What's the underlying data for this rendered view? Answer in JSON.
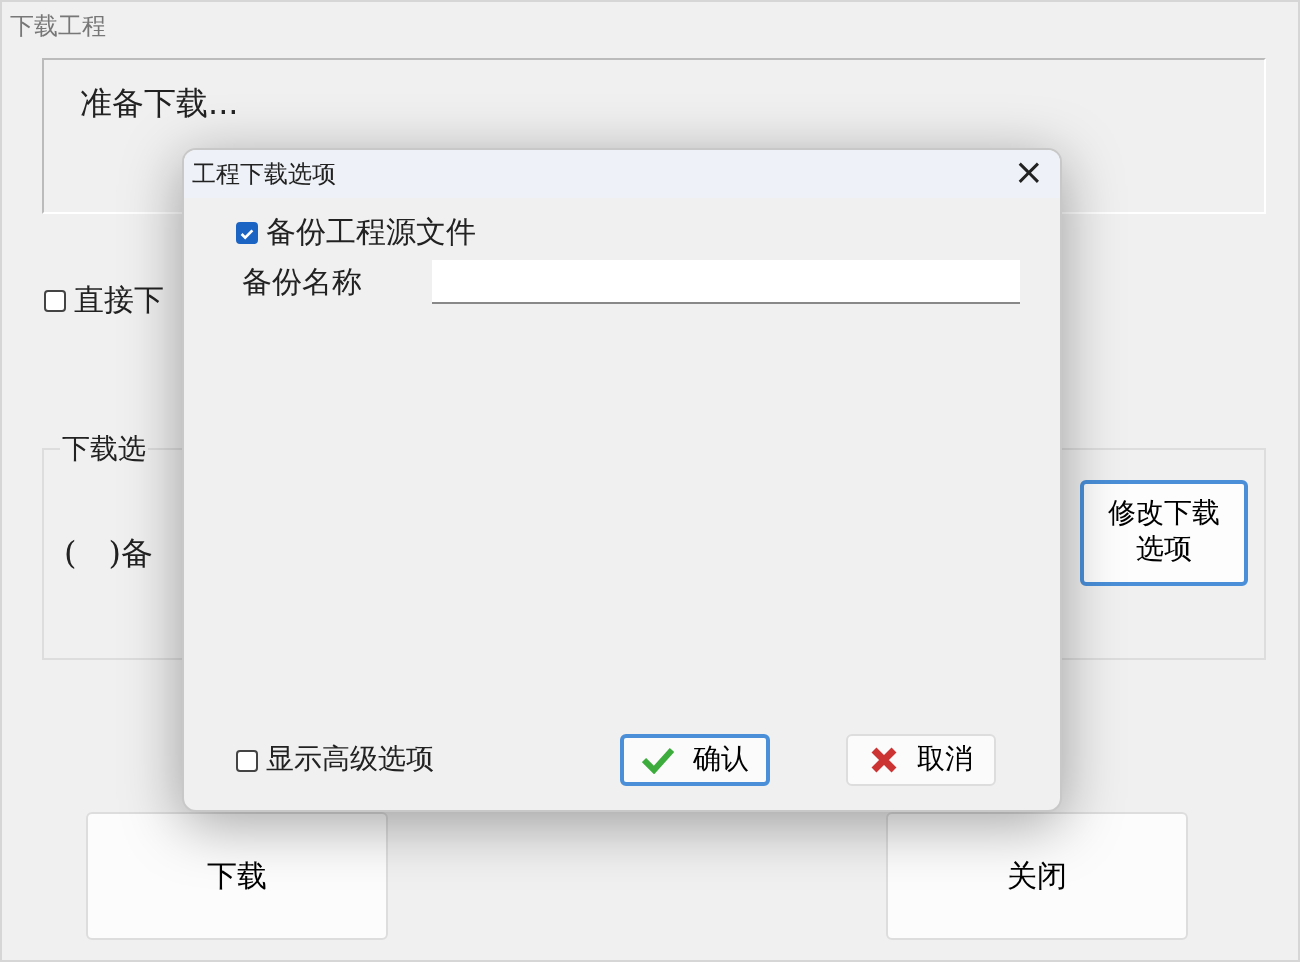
{
  "window": {
    "title": "下载工程"
  },
  "status": {
    "text": "准备下载..."
  },
  "direct_download": {
    "label": "直接下",
    "checked": false
  },
  "download_options": {
    "legend": "下载选",
    "summary": "(　)备",
    "modify_button": "修改下载选项"
  },
  "buttons": [
    {
      "label": "下载"
    },
    {
      "label": "关闭"
    }
  ],
  "dialog": {
    "title": "工程下载选项",
    "close": "×",
    "backup_source": {
      "label": "备份工程源文件",
      "checked": true
    },
    "backup_name": {
      "label": "备份名称"
    },
    "advanced": {
      "label": "显示高级选项",
      "checked": false
    },
    "buttons": [
      {
        "kind": "ok",
        "label": "确认"
      },
      {
        "kind": "cancel",
        "label": "取消"
      }
    ]
  }
}
